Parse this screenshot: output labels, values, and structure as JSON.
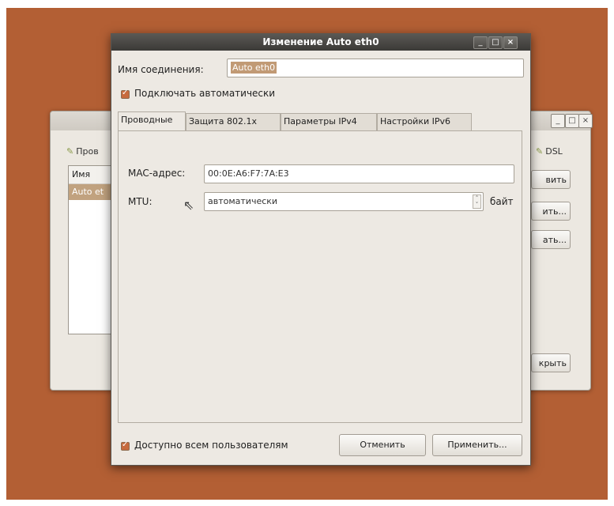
{
  "background_window": {
    "tabs": [
      "Пров",
      "DSL"
    ],
    "list_header": "Имя",
    "list_row": "Auto et",
    "buttons": [
      "вить",
      "ить...",
      "ать..."
    ],
    "close_button": "крыть",
    "window_controls": [
      "_",
      "□",
      "×"
    ]
  },
  "dialog": {
    "title": "Изменение Auto eth0",
    "window_controls": [
      "_",
      "□",
      "×"
    ],
    "connection_name_label": "Имя соединения:",
    "connection_name_value": "Auto eth0",
    "auto_connect_label": "Подключать автоматически",
    "tabs": [
      "Проводные",
      "Защита 802.1x",
      "Параметры IPv4",
      "Настройки IPv6"
    ],
    "mac_label": "MAC-адрес:",
    "mac_value": "00:0E:A6:F7:7A:E3",
    "mtu_label": "MTU:",
    "mtu_value": "автоматически",
    "mtu_unit": "байт",
    "available_to_all_label": "Доступно всем пользователям",
    "cancel_button": "Отменить",
    "apply_button": "Применить..."
  },
  "colors": {
    "desktop": "#b35f34",
    "titlebar": "#3b3a37",
    "selection": "#c19a75",
    "checkbox": "#c76b3e"
  }
}
